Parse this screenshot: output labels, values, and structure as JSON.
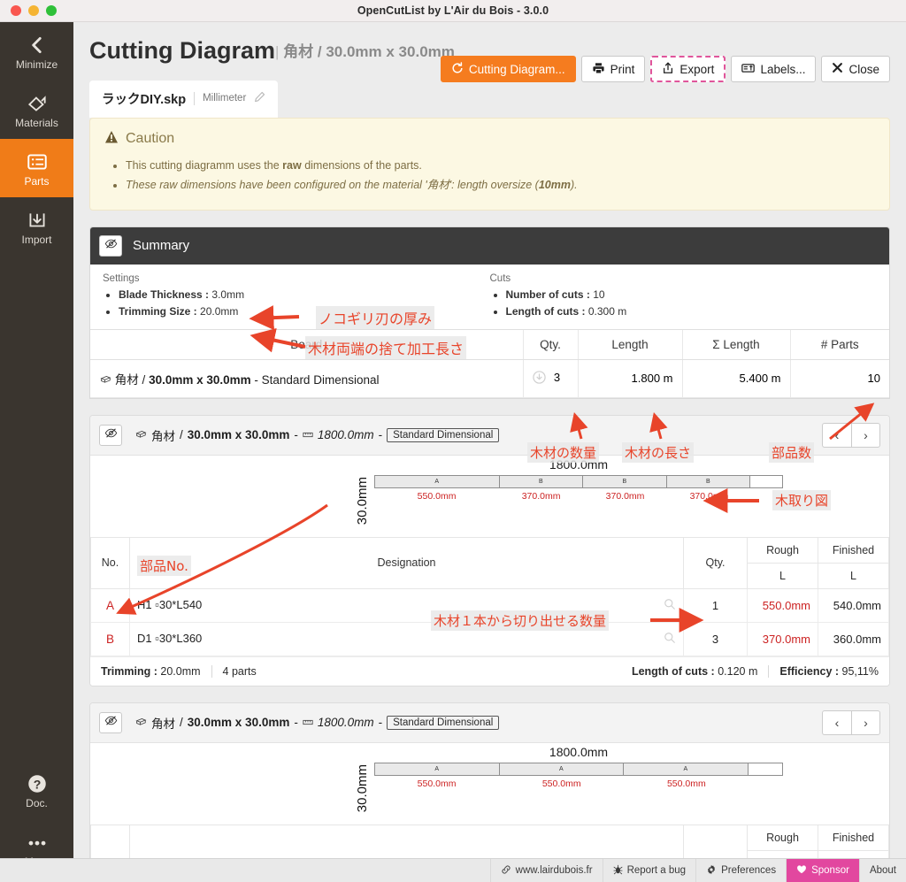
{
  "window": {
    "title": "OpenCutList by L'Air du Bois - 3.0.0"
  },
  "sidebar": {
    "items": [
      {
        "label": "Minimize",
        "icon": "chevron-left-icon"
      },
      {
        "label": "Materials",
        "icon": "materials-icon"
      },
      {
        "label": "Parts",
        "icon": "list-icon"
      },
      {
        "label": "Import",
        "icon": "import-icon"
      }
    ],
    "bottom_items": [
      {
        "label": "Doc.",
        "icon": "question-circle-icon"
      },
      {
        "label": "More",
        "icon": "ellipsis-icon"
      }
    ]
  },
  "header": {
    "title": "Cutting Diagram",
    "separator": "|",
    "subtitle": "角材 / 30.0mm x 30.0mm"
  },
  "toolbar": {
    "cutting_diagram_label": "Cutting Diagram...",
    "print_label": "Print",
    "export_label": "Export",
    "labels_label": "Labels...",
    "close_label": "Close"
  },
  "tab": {
    "filename": "ラックDIY.skp",
    "unit": "Millimeter"
  },
  "caution": {
    "heading": "Caution",
    "items": [
      "This cutting diagramm uses the raw dimensions of the parts.",
      "These raw dimensions have been configured on the material '角材': length oversize (10mm)."
    ],
    "bullet1_pre": "This cutting diagramm uses the ",
    "bullet1_bold": "raw",
    "bullet1_post": " dimensions of the parts.",
    "bullet2_pre": "These raw dimensions have been configured on the material '角材': length oversize (",
    "bullet2_bold": "10mm",
    "bullet2_post": ")."
  },
  "summary": {
    "title": "Summary",
    "settings_label": "Settings",
    "settings": [
      {
        "key": "Blade Thickness :",
        "value": "3.0mm"
      },
      {
        "key": "Trimming Size :",
        "value": "20.0mm"
      }
    ],
    "cuts_label": "Cuts",
    "cuts": [
      {
        "key": "Number of cuts :",
        "value": "10"
      },
      {
        "key": "Length of cuts :",
        "value": "0.300 m"
      }
    ],
    "columns": [
      "Board",
      "Qty.",
      "Length",
      "Σ Length",
      "# Parts"
    ],
    "rows": [
      {
        "board_material": "角材",
        "board_sep": "/",
        "board_dim": "30.0mm x 30.0mm",
        "board_type": "- Standard Dimensional",
        "qty": "3",
        "length": "1.800 m",
        "sum_length": "5.400 m",
        "parts": "10"
      }
    ]
  },
  "panels": [
    {
      "title_material": "角材",
      "title_dim": "30.0mm x 30.0mm",
      "title_len": "1800.0mm",
      "title_chip": "Standard Dimensional",
      "prev": "‹",
      "next": "›",
      "bar": {
        "length_label": "1800.0mm",
        "height_label": "30.0mm",
        "total": 1800,
        "segments": [
          {
            "letter": "A",
            "dim": "550.0mm",
            "value": 550
          },
          {
            "letter": "B",
            "dim": "370.0mm",
            "value": 370
          },
          {
            "letter": "B",
            "dim": "370.0mm",
            "value": 370
          },
          {
            "letter": "B",
            "dim": "370.0mm",
            "value": 370
          },
          {
            "letter": "",
            "dim": "",
            "value": 140,
            "empty": true
          }
        ]
      },
      "table": {
        "col_no": "No.",
        "col_designation": "Designation",
        "col_qty": "Qty.",
        "col_rough": "Rough",
        "col_finished": "Finished",
        "sub_rough": "L",
        "sub_finished": "L",
        "rows": [
          {
            "no": "A",
            "designation": "H1 ▫30*L540",
            "qty": "1",
            "rough": "550.0mm",
            "finished": "540.0mm"
          },
          {
            "no": "B",
            "designation": "D1 ▫30*L360",
            "qty": "3",
            "rough": "370.0mm",
            "finished": "360.0mm"
          }
        ]
      },
      "footer": {
        "trimming_key": "Trimming :",
        "trimming_value": "20.0mm",
        "parts": "4 parts",
        "cuts_key": "Length of cuts :",
        "cuts_value": "0.120 m",
        "efficiency_key": "Efficiency :",
        "efficiency_value": "95,11%"
      }
    },
    {
      "title_material": "角材",
      "title_dim": "30.0mm x 30.0mm",
      "title_len": "1800.0mm",
      "title_chip": "Standard Dimensional",
      "prev": "‹",
      "next": "›",
      "bar": {
        "length_label": "1800.0mm",
        "height_label": "30.0mm",
        "total": 1800,
        "segments": [
          {
            "letter": "A",
            "dim": "550.0mm",
            "value": 550
          },
          {
            "letter": "A",
            "dim": "550.0mm",
            "value": 550
          },
          {
            "letter": "A",
            "dim": "550.0mm",
            "value": 550
          },
          {
            "letter": "",
            "dim": "",
            "value": 150,
            "empty": true
          }
        ]
      },
      "table": {
        "col_rough": "Rough",
        "col_finished": "Finished"
      }
    }
  ],
  "annotations": [
    {
      "id": "blade",
      "text": "ノコギリ刃の厚み"
    },
    {
      "id": "trimming",
      "text": "木材両端の捨て加工長さ"
    },
    {
      "id": "qty",
      "text": "木材の数量"
    },
    {
      "id": "length",
      "text": "木材の長さ"
    },
    {
      "id": "parts-count",
      "text": "部品数"
    },
    {
      "id": "diagram",
      "text": "木取り図"
    },
    {
      "id": "part-no",
      "text": "部品No."
    },
    {
      "id": "per-board",
      "text": "木材１本から切り出せる数量"
    }
  ],
  "statusbar": {
    "items": [
      {
        "label": "www.lairdubois.fr",
        "icon": "link-icon"
      },
      {
        "label": "Report a bug",
        "icon": "bug-icon"
      },
      {
        "label": "Preferences",
        "icon": "gear-icon"
      },
      {
        "label": "Sponsor",
        "icon": "heart-icon"
      },
      {
        "label": "About",
        "icon": ""
      }
    ]
  },
  "colors": {
    "accent": "#f07c18",
    "sponsor": "#e2479f",
    "annotation": "#e8442a",
    "caution_bg": "#fcf8e3"
  }
}
